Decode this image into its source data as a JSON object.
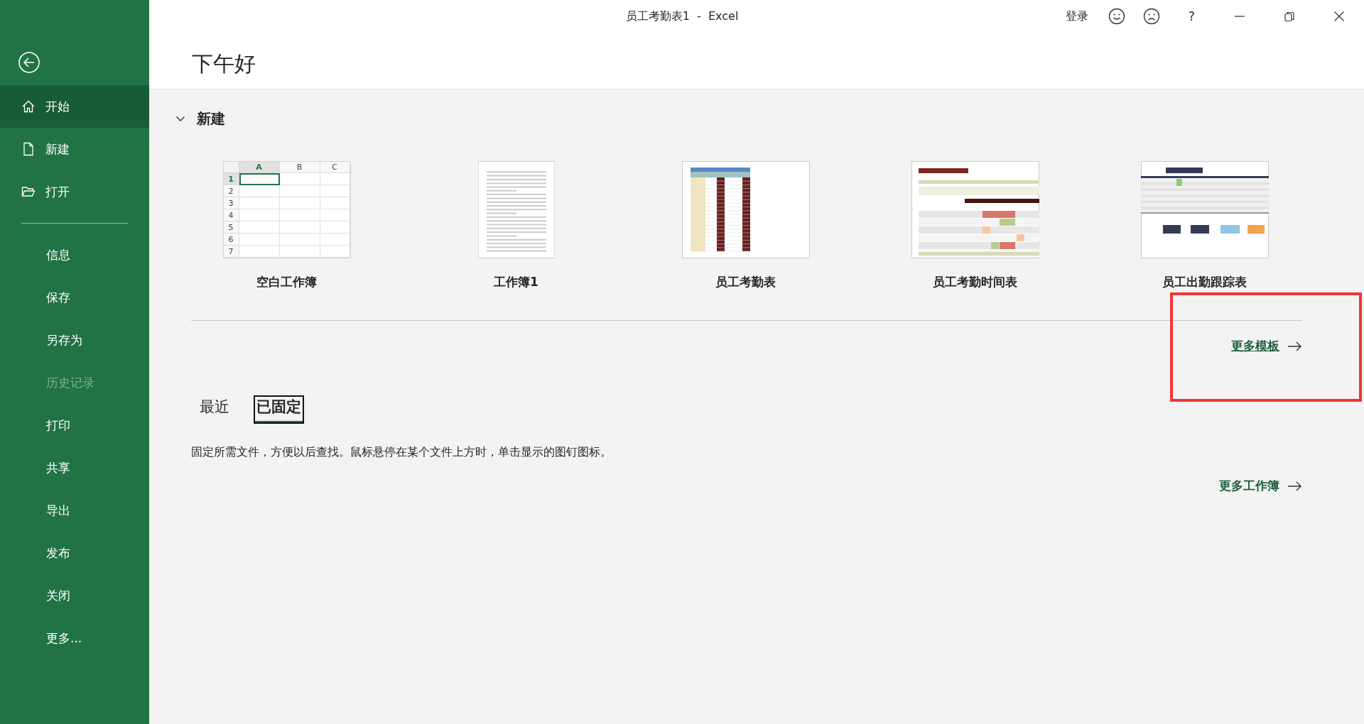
{
  "window": {
    "title": "员工考勤表1  -  Excel",
    "sign_in": "登录",
    "help": "?"
  },
  "sidebar": {
    "primary": [
      {
        "label": "开始",
        "kind": "home",
        "selected": true,
        "disabled": false
      },
      {
        "label": "新建",
        "kind": "new",
        "selected": false,
        "disabled": false
      },
      {
        "label": "打开",
        "kind": "open",
        "selected": false,
        "disabled": false
      }
    ],
    "secondary": [
      {
        "label": "信息",
        "selected": false,
        "disabled": false
      },
      {
        "label": "保存",
        "selected": false,
        "disabled": false
      },
      {
        "label": "另存为",
        "selected": false,
        "disabled": false
      },
      {
        "label": "历史记录",
        "selected": false,
        "disabled": true
      },
      {
        "label": "打印",
        "selected": false,
        "disabled": false
      },
      {
        "label": "共享",
        "selected": false,
        "disabled": false
      },
      {
        "label": "导出",
        "selected": false,
        "disabled": false
      },
      {
        "label": "发布",
        "selected": false,
        "disabled": false
      },
      {
        "label": "关闭",
        "selected": false,
        "disabled": false
      },
      {
        "label": "更多...",
        "selected": false,
        "disabled": false
      }
    ]
  },
  "greeting": "下午好",
  "new_section": {
    "title": "新建",
    "expanded": true,
    "templates": [
      {
        "kind": "blank",
        "name": "空白工作簿",
        "columns": [
          "A",
          "B",
          "C"
        ],
        "rows": [
          "1",
          "2",
          "3",
          "4",
          "5",
          "6",
          "7"
        ]
      },
      {
        "kind": "document",
        "name": "工作簿1"
      },
      {
        "kind": "attendance",
        "name": "员工考勤表"
      },
      {
        "kind": "timesheet",
        "name": "员工考勤时间表"
      },
      {
        "kind": "tracker",
        "name": "员工出勤跟踪表"
      }
    ],
    "more_link": "更多模板"
  },
  "files": {
    "tabs": [
      {
        "label": "最近",
        "selected": false
      },
      {
        "label": "已固定",
        "selected": true
      }
    ],
    "hint": "固定所需文件，方便以后查找。鼠标悬停在某个文件上方时，单击显示的图钉图标。",
    "more_link": "更多工作簿"
  },
  "annotation": {
    "kind": "highlight-frame"
  }
}
